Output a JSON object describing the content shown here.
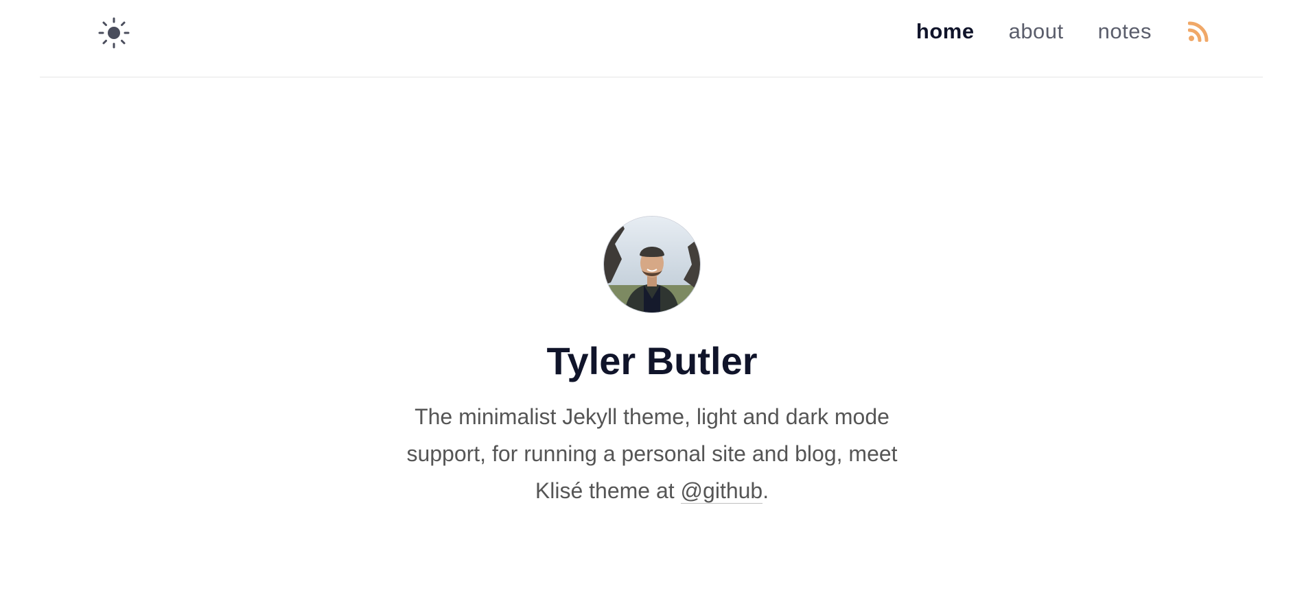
{
  "nav": {
    "theme_toggle_icon": "sun-icon",
    "links": [
      {
        "label": "home",
        "active": true
      },
      {
        "label": "about",
        "active": false
      },
      {
        "label": "notes",
        "active": false
      }
    ],
    "rss_icon": "rss-icon",
    "rss_color": "#f0a868"
  },
  "hero": {
    "avatar_alt": "profile-photo",
    "name": "Tyler Butler",
    "bio_before_link": "The minimalist Jekyll theme, light and dark mode support, for running a personal site and blog, meet Klisé theme at ",
    "bio_link_text": "@github",
    "bio_after_link": "."
  },
  "colors": {
    "text_dark": "#10142a",
    "text_muted": "#5a5d6b",
    "body_text": "#555555",
    "accent_rss": "#f0a868"
  }
}
